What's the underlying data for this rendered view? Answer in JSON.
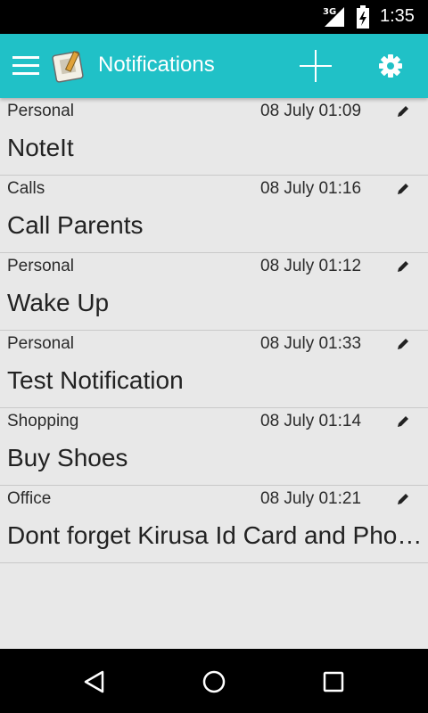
{
  "status_bar": {
    "network_type": "3G",
    "time": "1:35",
    "icons": [
      "signal-icon",
      "battery-charging-icon"
    ]
  },
  "app_bar": {
    "title": "Notifications",
    "icons": [
      "menu-icon",
      "app-logo-icon",
      "add-icon",
      "settings-icon"
    ],
    "color": "#20c1c7"
  },
  "notifications": [
    {
      "category": "Personal",
      "datetime": "08 July 01:09",
      "title": "NoteIt"
    },
    {
      "category": "Calls",
      "datetime": "08 July 01:16",
      "title": "Call Parents"
    },
    {
      "category": "Personal",
      "datetime": "08 July 01:12",
      "title": "Wake Up"
    },
    {
      "category": "Personal",
      "datetime": "08 July 01:33",
      "title": "Test Notification"
    },
    {
      "category": "Shopping",
      "datetime": "08 July 01:14",
      "title": "Buy Shoes"
    },
    {
      "category": "Office",
      "datetime": "08 July 01:21",
      "title": "Dont forget Kirusa Id Card and Phone"
    }
  ],
  "nav_bar": {
    "icons": [
      "back-icon",
      "home-icon",
      "recents-icon"
    ]
  }
}
